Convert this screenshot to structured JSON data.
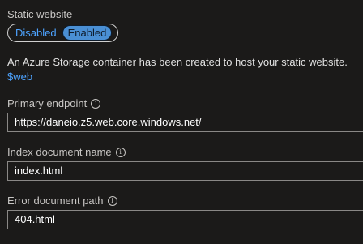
{
  "static_website": {
    "label": "Static website",
    "toggle": {
      "options": [
        "Disabled",
        "Enabled"
      ],
      "selected": "Enabled"
    }
  },
  "info": {
    "message": "An Azure Storage container has been created to host your static website.",
    "container_link": "$web"
  },
  "primary_endpoint": {
    "label": "Primary endpoint",
    "value": "https://daneio.z5.web.core.windows.net/"
  },
  "index_document": {
    "label": "Index document name",
    "value": "index.html"
  },
  "error_document": {
    "label": "Error document path",
    "value": "404.html"
  },
  "icons": {
    "info": "info-icon"
  }
}
